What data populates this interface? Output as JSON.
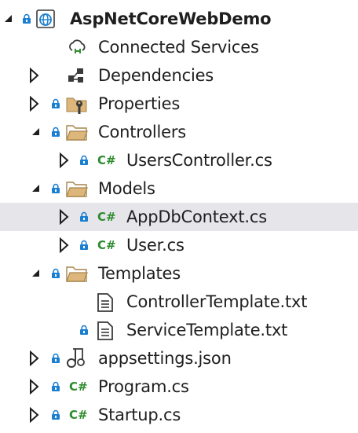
{
  "solution_explorer": {
    "project": {
      "label": "AspNetCoreWebDemo",
      "icon": "web-project-icon",
      "expanded": true
    },
    "nodes": [
      {
        "label": "Connected Services",
        "icon": "connected-services-icon"
      },
      {
        "label": "Dependencies",
        "icon": "dependencies-icon",
        "expanded": false
      },
      {
        "label": "Properties",
        "icon": "properties-folder-icon",
        "expanded": false
      },
      {
        "label": "Controllers",
        "icon": "folder-icon",
        "expanded": true
      },
      {
        "label": "UsersController.cs",
        "icon": "csharp-file-icon",
        "expanded": false
      },
      {
        "label": "Models",
        "icon": "folder-icon",
        "expanded": true
      },
      {
        "label": "AppDbContext.cs",
        "icon": "csharp-file-icon",
        "expanded": false,
        "selected": true
      },
      {
        "label": "User.cs",
        "icon": "csharp-file-icon",
        "expanded": false
      },
      {
        "label": "Templates",
        "icon": "folder-icon",
        "expanded": true
      },
      {
        "label": "ControllerTemplate.txt",
        "icon": "text-file-icon"
      },
      {
        "label": "ServiceTemplate.txt",
        "icon": "text-file-icon"
      },
      {
        "label": "appsettings.json",
        "icon": "json-file-icon",
        "expanded": false
      },
      {
        "label": "Program.cs",
        "icon": "csharp-file-icon",
        "expanded": false
      },
      {
        "label": "Startup.cs",
        "icon": "csharp-file-icon",
        "expanded": false
      }
    ],
    "csharp_glyph": "C#",
    "colors": {
      "lock_blue": "#1b7fd1",
      "folder_tan": "#dcb67a",
      "csharp_green": "#2e8b2e",
      "selection_bg": "#e5e5ea",
      "arrow": "#1e1e1e"
    }
  }
}
